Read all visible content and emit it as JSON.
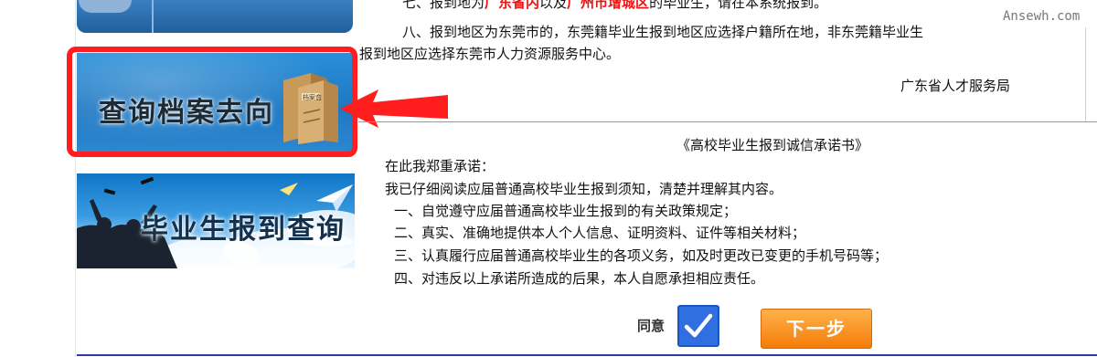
{
  "sidebar": {
    "archive_banner_label": "查询档案去向",
    "box_label": "档案盒",
    "graduate_banner_label": "毕业生报到查询"
  },
  "notice": {
    "line7_prefix": "七、报到地为",
    "line7_red1": "广东省内",
    "line7_mid": "以及",
    "line7_red2": "广州市增城区",
    "line7_suffix": "的毕业生，请在本系统报到。",
    "line8_a": "八、报到地区为东莞市的，东莞籍毕业生报到地区应选择户籍所在地，非东莞籍毕业生",
    "line8_b": "报到地区应选择东莞市人力资源服务中心。",
    "signature": "广东省人才服务局"
  },
  "commitment": {
    "title": "《高校毕业生报到诚信承诺书》",
    "intro": "在此我郑重承诺：",
    "line1": "我已仔细阅读应届普通高校毕业生报到须知，清楚并理解其内容。",
    "items": [
      "一、自觉遵守应届普通高校毕业生报到的有关政策规定；",
      "二、真实、准确地提供本人个人信息、证明资料、证件等相关材料；",
      "三、认真履行应届普通高校毕业生的各项义务，如及时更改已变更的手机号码等；",
      "四、对违反以上承诺所造成的后果，本人自愿承担相应责任。"
    ]
  },
  "form": {
    "agree_label": "同意",
    "agree_checked": true,
    "next_button": "下一步"
  },
  "watermark": "Ansewh.com",
  "colors": {
    "highlight_frame": "#ff1d1d",
    "checkbox": "#2f6fe0",
    "next_button": "#f47c0a",
    "notice_red": "#e11111"
  }
}
